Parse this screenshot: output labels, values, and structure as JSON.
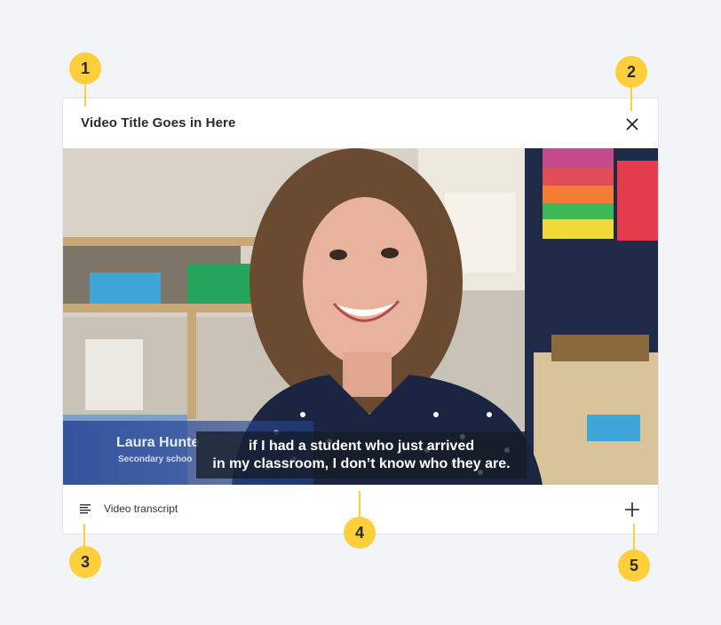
{
  "modal": {
    "title": "Video Title Goes in Here",
    "close_icon": "close-icon"
  },
  "video": {
    "subtitle_line1": "if I had a student who just arrived",
    "subtitle_line2": "in my classroom, I don’t know who they are.",
    "lower_third_name": "Laura Hunte",
    "lower_third_role": "Secondary schoo"
  },
  "footer": {
    "transcript_icon": "text-lines-icon",
    "transcript_label": "Video transcript",
    "expand_icon": "plus-icon"
  },
  "annotations": {
    "m1": "1",
    "m2": "2",
    "m3": "3",
    "m4": "4",
    "m5": "5"
  },
  "colors": {
    "background": "#f3f4f7",
    "marker": "#fdd03b",
    "text": "#2b2b2b"
  }
}
